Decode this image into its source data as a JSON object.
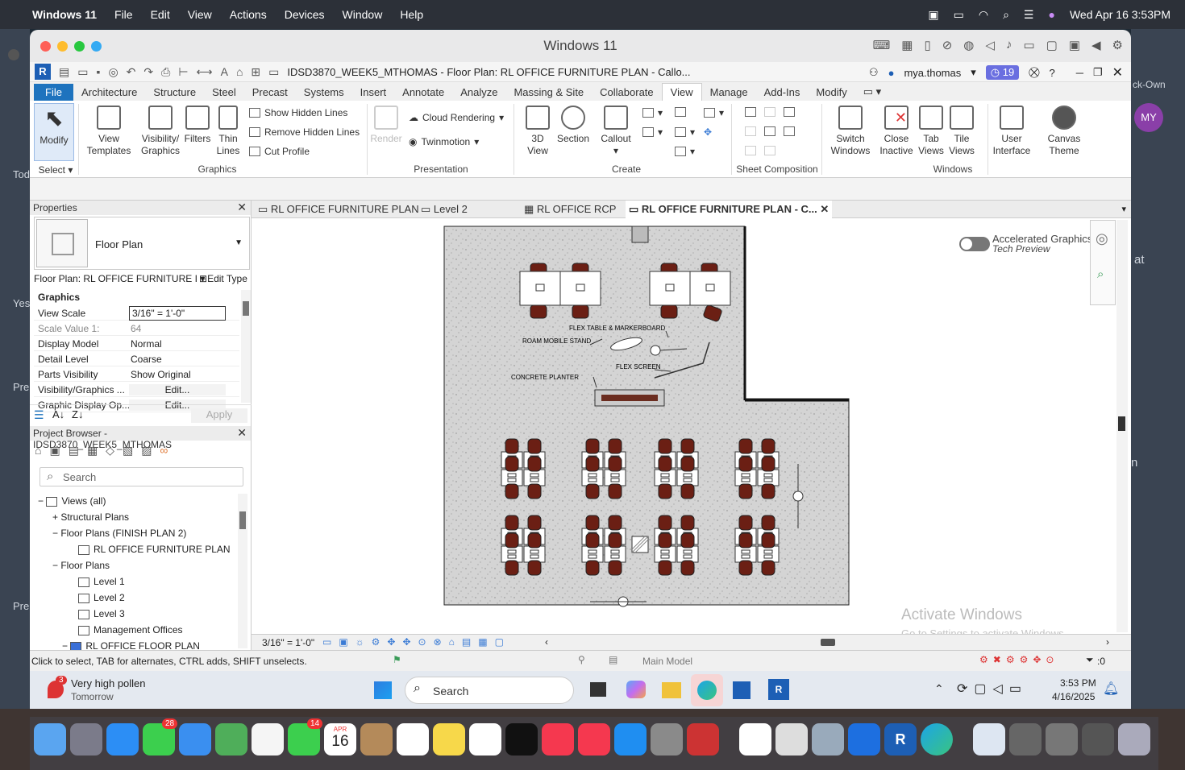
{
  "macos_menubar": {
    "app": "Windows 11",
    "menus": [
      "File",
      "Edit",
      "View",
      "Actions",
      "Devices",
      "Window",
      "Help"
    ],
    "clock": "Wed Apr 16  3:53PM"
  },
  "vm_window": {
    "title": "Windows 11"
  },
  "background_snippets": [
    "Tod",
    "Yes",
    "Pre",
    "Pre",
    "at",
    "n",
    "ck-Own",
    "MY"
  ],
  "revit": {
    "title": "IDSD3870_WEEK5_MTHOMAS - Floor Plan: RL OFFICE FURNITURE PLAN - Callo...",
    "user": "mya.thomas",
    "notification_count": "19",
    "ribbon_tabs": [
      "File",
      "Architecture",
      "Structure",
      "Steel",
      "Precast",
      "Systems",
      "Insert",
      "Annotate",
      "Analyze",
      "Massing & Site",
      "Collaborate",
      "View",
      "Manage",
      "Add-Ins",
      "Modify"
    ],
    "active_tab": "View",
    "ribbon": {
      "modify": "Modify",
      "select": "Select",
      "view_templates": "View\nTemplates",
      "visibility": "Visibility/\nGraphics",
      "filters": "Filters",
      "thin_lines": "Thin\nLines",
      "show_hidden": "Show  Hidden Lines",
      "remove_hidden": "Remove  Hidden Lines",
      "cut_profile": "Cut  Profile",
      "graphics_group": "Graphics",
      "render": "Render",
      "cloud_rendering": "Cloud  Rendering",
      "twinmotion": "Twinmotion",
      "presentation_group": "Presentation",
      "view_3d": "3D\nView",
      "section": "Section",
      "callout": "Callout",
      "create_group": "Create",
      "sheet_comp_group": "Sheet Composition",
      "switch_windows": "Switch\nWindows",
      "close_inactive": "Close\nInactive",
      "tab_views": "Tab\nViews",
      "tile_views": "Tile\nViews",
      "windows_group": "Windows",
      "user_interface": "User\nInterface",
      "canvas_theme": "Canvas\nTheme"
    },
    "properties": {
      "header": "Properties",
      "type": "Floor Plan",
      "selector": "Floor Plan: RL OFFICE FURNITURE I",
      "edit_type": "Edit Type",
      "group": "Graphics",
      "rows": [
        {
          "k": "View Scale",
          "v": "3/16\" = 1'-0\""
        },
        {
          "k": "Scale Value    1:",
          "v": "64"
        },
        {
          "k": "Display Model",
          "v": "Normal"
        },
        {
          "k": "Detail Level",
          "v": "Coarse"
        },
        {
          "k": "Parts Visibility",
          "v": "Show Original"
        },
        {
          "k": "Visibility/Graphics ...",
          "v": "Edit..."
        },
        {
          "k": "Graphic Display Op...",
          "v": "Edit..."
        }
      ],
      "apply": "Apply"
    },
    "browser": {
      "header": "Project Browser - IDSD3870_WEEK5_MTHOMAS",
      "search": "Search",
      "items": [
        {
          "label": "Views (all)",
          "sign": "−"
        },
        {
          "label": "Structural Plans",
          "sign": "+"
        },
        {
          "label": "Floor Plans (FINISH PLAN 2)",
          "sign": "−"
        },
        {
          "label": "RL OFFICE FURNITURE PLAN",
          "sign": ""
        },
        {
          "label": "Floor Plans",
          "sign": "−"
        },
        {
          "label": "Level 1",
          "sign": ""
        },
        {
          "label": "Level 2",
          "sign": ""
        },
        {
          "label": "Level 3",
          "sign": ""
        },
        {
          "label": "Management Offices",
          "sign": ""
        },
        {
          "label": "RL OFFICE FLOOR PLAN",
          "sign": "−"
        }
      ]
    },
    "view_tabs": [
      "RL OFFICE FURNITURE PLAN",
      "Level 2",
      "RL OFFICE RCP",
      "RL OFFICE FURNITURE PLAN - C..."
    ],
    "canvas": {
      "accel_title": "Accelerated Graphics",
      "accel_sub": "Tech Preview",
      "labels": [
        "FLEX TABLE & MARKERBOARD",
        "ROAM MOBILE STAND",
        "FLEX SCREEN",
        "CONCRETE PLANTER"
      ],
      "watermark_title": "Activate Windows",
      "watermark_sub": "Go to Settings to activate Windows."
    },
    "view_scale": "3/16\" = 1'-0\"",
    "status_text": "Click to select, TAB for alternates, CTRL adds, SHIFT unselects.",
    "model": "Main Model",
    "filter_count": ":0"
  },
  "taskbar": {
    "weather_badge": "3",
    "weather_title": "Very high pollen",
    "weather_sub": "Tomorrow",
    "search": "Search",
    "time": "3:53 PM",
    "date": "4/16/2025"
  },
  "dock": {
    "messages_badge": "28",
    "facetime_badge": "14",
    "cal_month": "APR",
    "cal_day": "16"
  }
}
